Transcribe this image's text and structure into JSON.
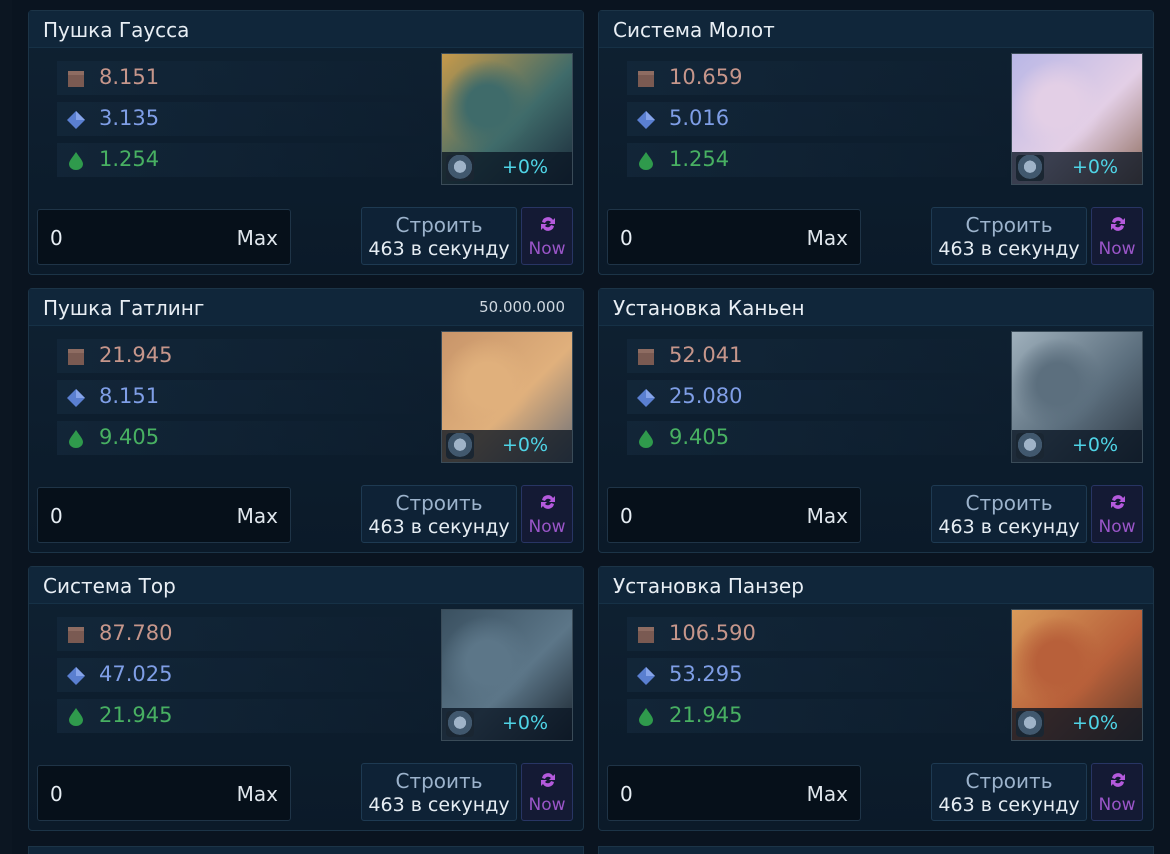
{
  "colors": {
    "metal": "#c6968b",
    "crystal": "#7f9ee6",
    "deuterium": "#48b062",
    "bonus": "#4fd4e6",
    "now": "#9a55c8",
    "build_label": "#9cb3cc"
  },
  "icons": {
    "metal": "metal-icon",
    "crystal": "crystal-icon",
    "deuterium": "deuterium-icon",
    "now": "refresh-icon",
    "thumb_mini": "defense-icon"
  },
  "cards": [
    {
      "title": "Пушка Гаусса",
      "extra": "",
      "metal": "8.151",
      "crystal": "3.135",
      "deuterium": "1.254",
      "bonus": "+0%",
      "quantity": "0",
      "max_label": "Max",
      "build_label": "Строить",
      "rate": "463 в секунду",
      "now_label": "Now",
      "thumb_colors": [
        "#c79a4a",
        "#3f6b6a",
        "#1b2a3a"
      ]
    },
    {
      "title": "Система Молот",
      "extra": "",
      "metal": "10.659",
      "crystal": "5.016",
      "deuterium": "1.254",
      "bonus": "+0%",
      "quantity": "0",
      "max_label": "Max",
      "build_label": "Строить",
      "rate": "463 в секунду",
      "now_label": "Now",
      "thumb_colors": [
        "#b9b7e6",
        "#e3cfe6",
        "#8c6a5a"
      ]
    },
    {
      "title": "Пушка Гатлинг",
      "extra": "50.000.000",
      "metal": "21.945",
      "crystal": "8.151",
      "deuterium": "9.405",
      "bonus": "+0%",
      "quantity": "0",
      "max_label": "Max",
      "build_label": "Строить",
      "rate": "463 в секунду",
      "now_label": "Now",
      "thumb_colors": [
        "#c8956a",
        "#e0b07c",
        "#6b6f78"
      ]
    },
    {
      "title": "Установка Каньен",
      "extra": "",
      "metal": "52.041",
      "crystal": "25.080",
      "deuterium": "9.405",
      "bonus": "+0%",
      "quantity": "0",
      "max_label": "Max",
      "build_label": "Строить",
      "rate": "463 в секунду",
      "now_label": "Now",
      "thumb_colors": [
        "#9fb0bc",
        "#5c6f7e",
        "#2b3540"
      ]
    },
    {
      "title": "Система Тор",
      "extra": "",
      "metal": "87.780",
      "crystal": "47.025",
      "deuterium": "21.945",
      "bonus": "+0%",
      "quantity": "0",
      "max_label": "Max",
      "build_label": "Строить",
      "rate": "463 в секунду",
      "now_label": "Now",
      "thumb_colors": [
        "#3a5060",
        "#5c7688",
        "#1a242e"
      ]
    },
    {
      "title": "Установка Панзер",
      "extra": "",
      "metal": "106.590",
      "crystal": "53.295",
      "deuterium": "21.945",
      "bonus": "+0%",
      "quantity": "0",
      "max_label": "Max",
      "build_label": "Строить",
      "rate": "463 в секунду",
      "now_label": "Now",
      "thumb_colors": [
        "#d89a5a",
        "#b8603a",
        "#5a3a2a"
      ]
    }
  ]
}
